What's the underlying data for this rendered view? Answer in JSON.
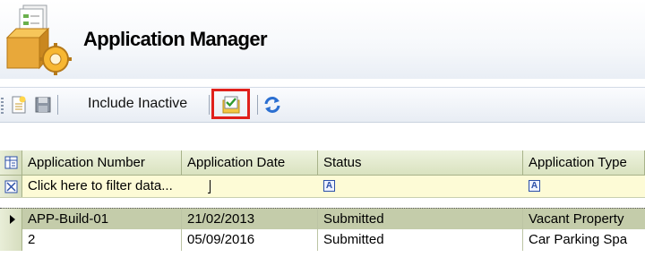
{
  "header": {
    "title": "Application Manager",
    "icon": "application-manager-icon"
  },
  "toolbar": {
    "include_inactive_label": "Include Inactive",
    "buttons": [
      "new-icon",
      "save-icon",
      "include-inactive-checkbox-icon",
      "refresh-icon"
    ]
  },
  "grid": {
    "columns": [
      "Application Number",
      "Application Date",
      "Status",
      "Application Type"
    ],
    "filter": {
      "placeholder": "Click here to filter data...",
      "glyph": "A"
    },
    "rows": [
      {
        "number": "APP-Build-01",
        "date": "21/02/2013",
        "status": "Submitted",
        "type": "Vacant Property"
      },
      {
        "number": "2",
        "date": "05/09/2016",
        "status": "Submitted",
        "type": "Car Parking Spa"
      }
    ]
  },
  "colors": {
    "highlight": "#e0201b",
    "selected_row": "#c4ccaa",
    "filter_row": "#fdfbd6"
  }
}
